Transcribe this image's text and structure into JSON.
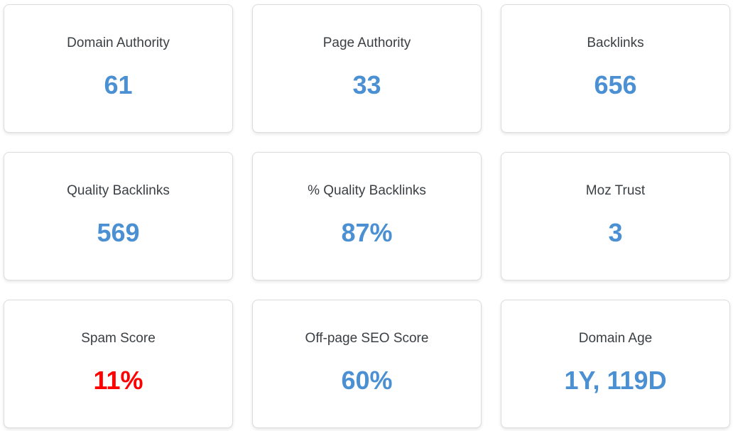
{
  "colors": {
    "value_default": "#4a90d2",
    "value_alert": "#ff0000"
  },
  "metrics": [
    {
      "label": "Domain Authority",
      "value": "61",
      "status": "normal"
    },
    {
      "label": "Page Authority",
      "value": "33",
      "status": "normal"
    },
    {
      "label": "Backlinks",
      "value": "656",
      "status": "normal"
    },
    {
      "label": "Quality Backlinks",
      "value": "569",
      "status": "normal"
    },
    {
      "label": "% Quality Backlinks",
      "value": "87%",
      "status": "normal"
    },
    {
      "label": "Moz Trust",
      "value": "3",
      "status": "normal"
    },
    {
      "label": "Spam Score",
      "value": "11%",
      "status": "alert"
    },
    {
      "label": "Off-page SEO Score",
      "value": "60%",
      "status": "normal"
    },
    {
      "label": "Domain Age",
      "value": "1Y, 119D",
      "status": "normal"
    }
  ]
}
